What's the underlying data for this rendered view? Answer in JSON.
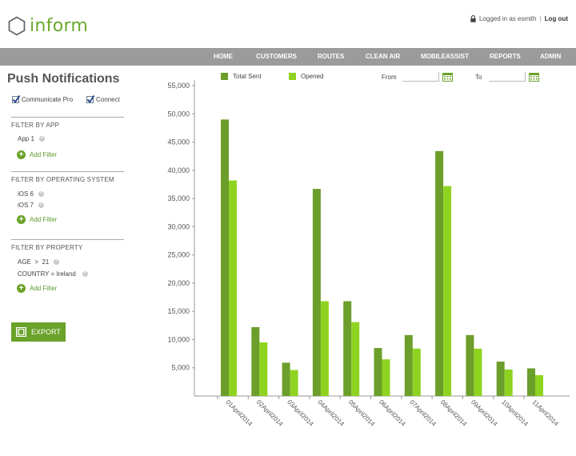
{
  "app": {
    "name": "inform",
    "accent": "#6aaa2c"
  },
  "user_bar": {
    "logged_in_text": "Logged in as esmith",
    "logout_label": "Log out"
  },
  "nav": {
    "items": [
      {
        "label": "HOME",
        "active": true
      },
      {
        "label": "CUSTOMERS"
      },
      {
        "label": "ROUTES"
      },
      {
        "label": "CLEAN AIR"
      },
      {
        "label": "MOBILEASSIST"
      },
      {
        "label": "REPORTS"
      },
      {
        "label": "ADMIN"
      }
    ]
  },
  "page": {
    "title": "Push Notifications"
  },
  "apps": [
    {
      "label": "Communicate Pro",
      "checked": true
    },
    {
      "label": "Connect",
      "checked": true
    }
  ],
  "filters": {
    "by_app": {
      "title": "FILTER BY APP",
      "items": [
        "App 1"
      ],
      "add_label": "Add Filter"
    },
    "by_os": {
      "title": "FILTER BY OPERATING SYSTEM",
      "items": [
        "iOS 6",
        "iOS 7"
      ],
      "add_label": "Add Filter"
    },
    "by_property": {
      "title": "FILTER BY PROPERTY",
      "items": [
        "AGE  >  21",
        "COUNTRY = Ireland"
      ],
      "add_label": "Add Filter"
    }
  },
  "export": {
    "label": "EXPORT"
  },
  "date_range": {
    "from_label": "From",
    "to_label": "To",
    "from_value": "",
    "to_value": ""
  },
  "chart_data": {
    "type": "bar",
    "categories": [
      "01April2014",
      "02April2014",
      "03April2014",
      "04April2014",
      "05April2014",
      "06April2014",
      "07April2014",
      "08April2014",
      "09April2014",
      "10April2014",
      "11April2014"
    ],
    "series": [
      {
        "name": "Total Sent",
        "color": "#6b9e2a",
        "values": [
          49000,
          12200,
          5900,
          36700,
          16800,
          8500,
          10800,
          43400,
          10800,
          6100,
          4900
        ]
      },
      {
        "name": "Opened",
        "color": "#8fd321",
        "values": [
          38200,
          9500,
          4600,
          16800,
          13100,
          6500,
          8400,
          37200,
          8400,
          4700,
          3700
        ]
      }
    ],
    "y_ticks": [
      5000,
      10000,
      15000,
      20000,
      25000,
      30000,
      35000,
      40000,
      45000,
      50000,
      55000
    ],
    "y_tick_labels": [
      "5,000",
      "10,000",
      "15,000",
      "20,000",
      "25,000",
      "30,000",
      "35,000",
      "40,000",
      "45,000",
      "50,000",
      "55,000"
    ],
    "ylim": [
      0,
      56000
    ],
    "grid": false,
    "legend_position": "top-left"
  }
}
